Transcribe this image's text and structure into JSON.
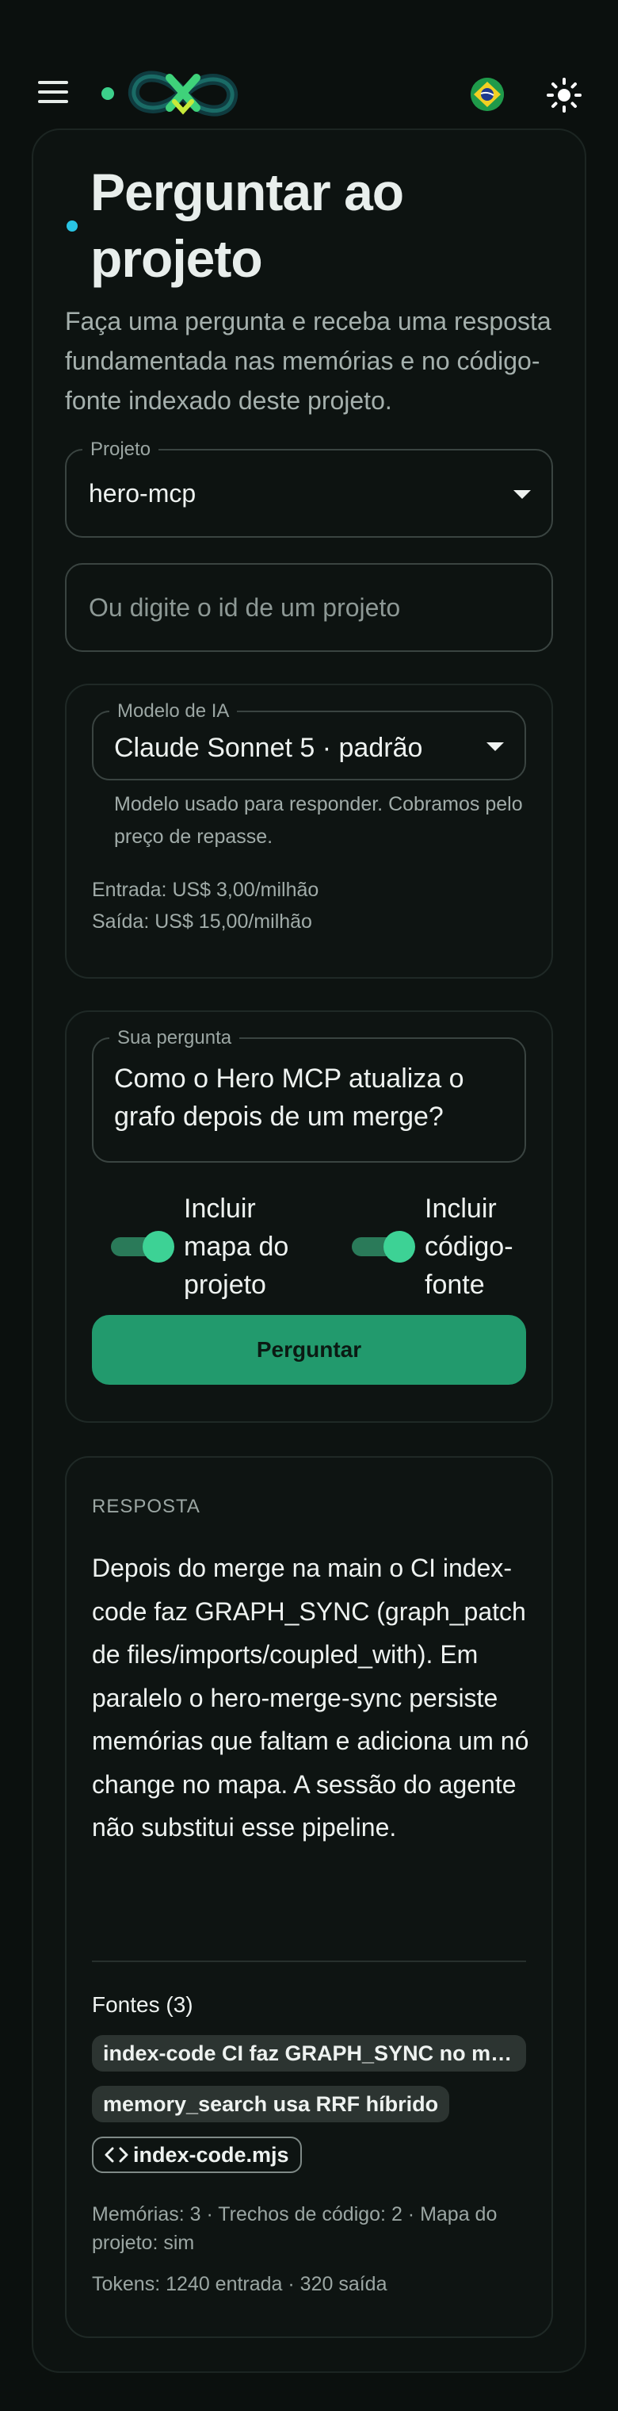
{
  "header": {
    "menu_icon": "hamburger-menu-icon",
    "logo_icon": "infinity-logo-icon",
    "language_icon": "brazil-flag-icon",
    "theme_icon": "sun-icon",
    "colors": {
      "accent_green": "#3ccf8a",
      "title_dot": "#29c4e3"
    }
  },
  "page": {
    "title": "Perguntar ao projeto",
    "subtitle": "Faça uma pergunta e receba uma resposta fundamentada nas memórias e no código-fonte indexado deste projeto."
  },
  "project": {
    "legend": "Projeto",
    "selected": "hero-mcp",
    "id_placeholder": "Ou digite o id de um projeto"
  },
  "model": {
    "legend": "Modelo de IA",
    "selected": "Claude Sonnet 5 · padrão",
    "help": "Modelo usado para responder. Cobramos pelo preço de repasse.",
    "input_price": "Entrada: US$ 3,00/milhão",
    "output_price": "Saída: US$ 15,00/milhão"
  },
  "question": {
    "legend": "Sua pergunta",
    "text": "Como o Hero MCP atualiza o grafo depois de um merge?",
    "toggle_map_label": "Incluir mapa do projeto",
    "toggle_map_on": true,
    "toggle_code_label": "Incluir código-fonte",
    "toggle_code_on": true,
    "submit_label": "Perguntar"
  },
  "answer": {
    "label": "RESPOSTA",
    "text": "Depois do merge na main o CI index-code faz GRAPH_SYNC (graph_patch de files/imports/coupled_with). Em paralelo o hero-merge-sync persiste memórias que faltam e adiciona um nó change no mapa. A sessão do agente não substitui esse pipeline.",
    "sources_title": "Fontes (3)",
    "sources": [
      {
        "label": "index-code CI faz GRAPH_SYNC no merge",
        "kind": "memory"
      },
      {
        "label": "memory_search usa RRF híbrido",
        "kind": "memory"
      },
      {
        "label": "index-code.mjs",
        "kind": "code",
        "icon": "code-brackets-icon"
      }
    ],
    "meta_counts": "Memórias: 3 · Trechos de código: 2 · Mapa do projeto: sim",
    "meta_tokens": "Tokens: 1240 entrada · 320 saída"
  }
}
